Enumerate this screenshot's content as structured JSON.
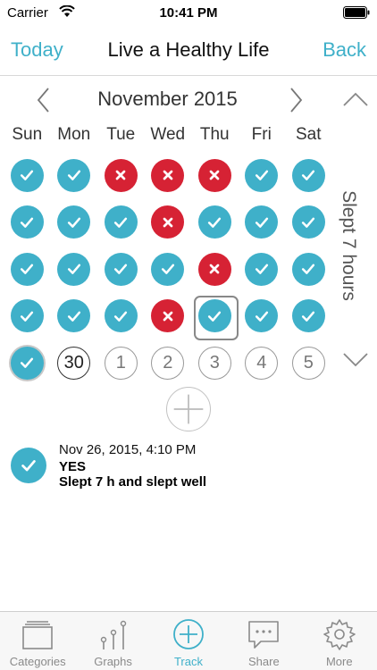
{
  "status_bar": {
    "carrier": "Carrier",
    "time": "10:41 PM"
  },
  "navbar": {
    "left": "Today",
    "title": "Live a Healthy Life",
    "right": "Back"
  },
  "calendar": {
    "month": "November 2015",
    "weekdays": [
      "Sun",
      "Mon",
      "Tue",
      "Wed",
      "Thu",
      "Fri",
      "Sat"
    ],
    "weeks": [
      [
        {
          "state": "yes"
        },
        {
          "state": "yes"
        },
        {
          "state": "no"
        },
        {
          "state": "no"
        },
        {
          "state": "no"
        },
        {
          "state": "yes"
        },
        {
          "state": "yes"
        }
      ],
      [
        {
          "state": "yes"
        },
        {
          "state": "yes"
        },
        {
          "state": "yes"
        },
        {
          "state": "no"
        },
        {
          "state": "yes"
        },
        {
          "state": "yes"
        },
        {
          "state": "yes"
        }
      ],
      [
        {
          "state": "yes"
        },
        {
          "state": "yes"
        },
        {
          "state": "yes"
        },
        {
          "state": "yes"
        },
        {
          "state": "no"
        },
        {
          "state": "yes"
        },
        {
          "state": "yes"
        }
      ],
      [
        {
          "state": "yes"
        },
        {
          "state": "yes"
        },
        {
          "state": "yes"
        },
        {
          "state": "no"
        },
        {
          "state": "yes",
          "selected": true
        },
        {
          "state": "yes"
        },
        {
          "state": "yes"
        }
      ],
      [
        {
          "state": "yes",
          "today": true
        },
        {
          "state": "day",
          "label": "30",
          "bold": true
        },
        {
          "state": "day",
          "label": "1"
        },
        {
          "state": "day",
          "label": "2"
        },
        {
          "state": "day",
          "label": "3"
        },
        {
          "state": "day",
          "label": "4"
        },
        {
          "state": "day",
          "label": "5"
        }
      ]
    ],
    "side_label": "Slept 7 hours"
  },
  "entry": {
    "date": "Nov 26, 2015, 4:10 PM",
    "answer": "YES",
    "note": "Slept 7 h and slept well"
  },
  "tabs": [
    {
      "label": "Categories",
      "icon": "categories-icon"
    },
    {
      "label": "Graphs",
      "icon": "graphs-icon"
    },
    {
      "label": "Track",
      "icon": "track-icon",
      "active": true
    },
    {
      "label": "Share",
      "icon": "share-icon"
    },
    {
      "label": "More",
      "icon": "gear-icon"
    }
  ],
  "colors": {
    "accent": "#3fb0c9",
    "no": "#d62234"
  }
}
